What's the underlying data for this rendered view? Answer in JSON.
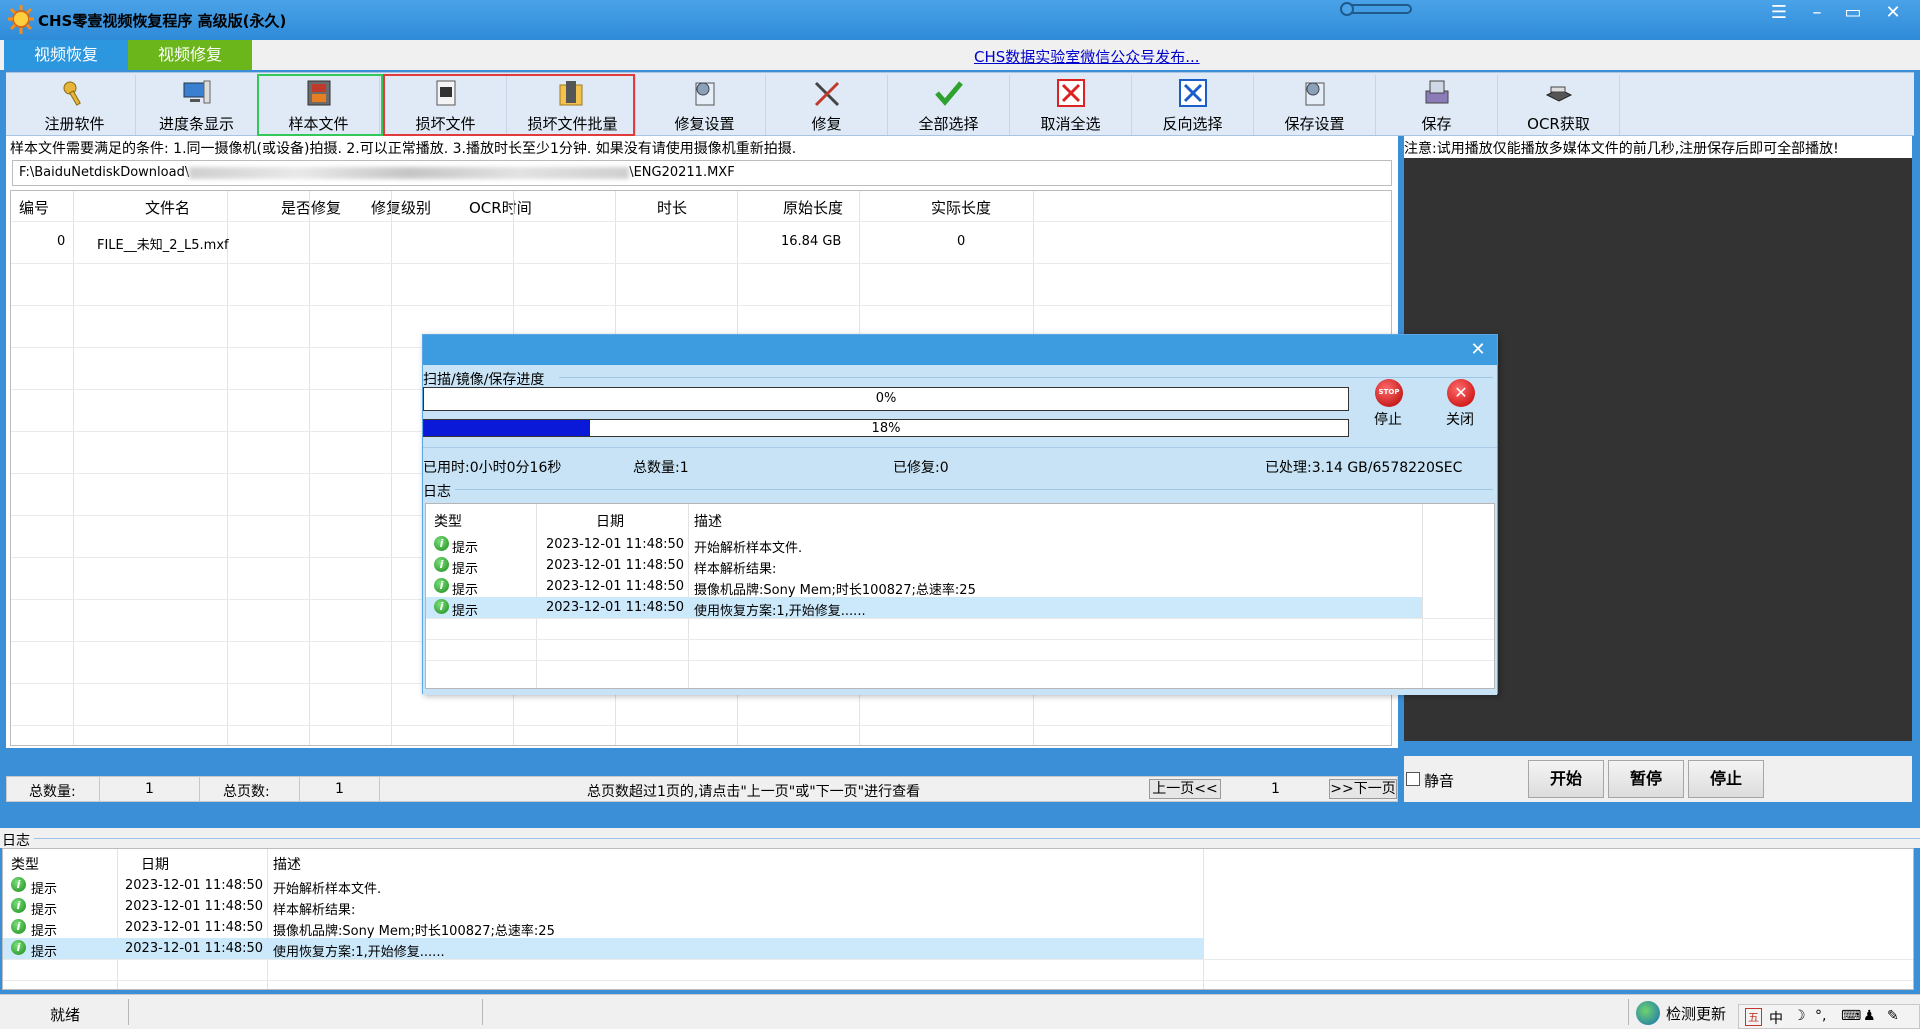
{
  "window": {
    "title": "CHS零壹视频恢复程序 高级版(永久)"
  },
  "menu": {
    "tabs": [
      {
        "label": "视频恢复"
      },
      {
        "label": "视频修复"
      }
    ],
    "link": "CHS数据实验室微信公众号发布..."
  },
  "toolbar": {
    "buttons": [
      {
        "label": "注册软件",
        "icon": "key-icon"
      },
      {
        "label": "进度条显示",
        "icon": "monitor-icon"
      },
      {
        "label": "样本文件",
        "icon": "film-icon"
      },
      {
        "label": "损坏文件",
        "icon": "document-film-icon"
      },
      {
        "label": "损坏文件批量",
        "icon": "folder-film-icon"
      },
      {
        "label": "修复设置",
        "icon": "settings-doc-icon"
      },
      {
        "label": "修复",
        "icon": "tools-icon"
      },
      {
        "label": "全部选择",
        "icon": "checkmark-icon"
      },
      {
        "label": "取消全选",
        "icon": "red-x-icon"
      },
      {
        "label": "反向选择",
        "icon": "blue-x-icon"
      },
      {
        "label": "保存设置",
        "icon": "settings-doc-icon"
      },
      {
        "label": "保存",
        "icon": "disk-icon"
      },
      {
        "label": "OCR获取",
        "icon": "scanner-icon"
      }
    ]
  },
  "main": {
    "hint": "样本文件需要满足的条件: 1.同一摄像机(或设备)拍摄. 2.可以正常播放. 3.播放时长至少1分钟. 如果没有请使用摄像机重新拍摄.",
    "path_prefix": "F:\\BaiduNetdiskDownload\\",
    "path_suffix": "\\ENG20211.MXF",
    "table": {
      "columns": [
        "编号",
        "文件名",
        "是否修复",
        "修复级别",
        "OCR时间",
        "时长",
        "原始长度",
        "实际长度"
      ],
      "rows": [
        {
          "id": "0",
          "name": "FILE__未知_2_L5.mxf",
          "repaired": "",
          "level": "",
          "ocr": "",
          "duration": "",
          "orig_len": "16.84 GB",
          "actual_len": "0"
        }
      ]
    }
  },
  "pager": {
    "total_count_label": "总数量:",
    "total_count": "1",
    "total_pages_label": "总页数:",
    "total_pages": "1",
    "note": "总页数超过1页的,请点击\"上一页\"或\"下一页\"进行查看",
    "prev": "上一页<<",
    "page": "1",
    "next": ">>下一页"
  },
  "right": {
    "note": "注意:试用播放仅能播放多媒体文件的前几秒,注册保存后即可全部播放!",
    "mute_label": "静音",
    "start": "开始",
    "pause": "暂停",
    "stop": "停止"
  },
  "log": {
    "title": "日志",
    "columns": [
      "类型",
      "日期",
      "描述"
    ],
    "rows": [
      {
        "type": "提示",
        "date": "2023-12-01 11:48:50",
        "desc": "开始解析样本文件."
      },
      {
        "type": "提示",
        "date": "2023-12-01 11:48:50",
        "desc": "样本解析结果:"
      },
      {
        "type": "提示",
        "date": "2023-12-01 11:48:50",
        "desc": "摄像机品牌:Sony Mem;时长100827;总速率:25"
      },
      {
        "type": "提示",
        "date": "2023-12-01 11:48:50",
        "desc": "使用恢复方案:1,开始修复......"
      }
    ]
  },
  "dialog": {
    "section": "扫描/镜像/保存进度",
    "progress1": "0%",
    "progress1_value": 0,
    "progress2": "18%",
    "progress2_value": 0.18,
    "stop": "停止",
    "close": "关闭",
    "elapsed": "已用时:0小时0分16秒",
    "total": "总数量:1",
    "repaired": "已修复:0",
    "processed": "已处理:3.14 GB/6578220SEC",
    "log_title": "日志"
  },
  "status": {
    "text": "就绪",
    "update": "检测更新",
    "tray": [
      "五",
      "中"
    ]
  },
  "colors": {
    "titlebar": "#2f8ad8",
    "tab_active": "#2c96df",
    "tab_green": "#6bb61a",
    "progress_fill": "#0a18d8",
    "highlight_row": "#cce8fb"
  }
}
